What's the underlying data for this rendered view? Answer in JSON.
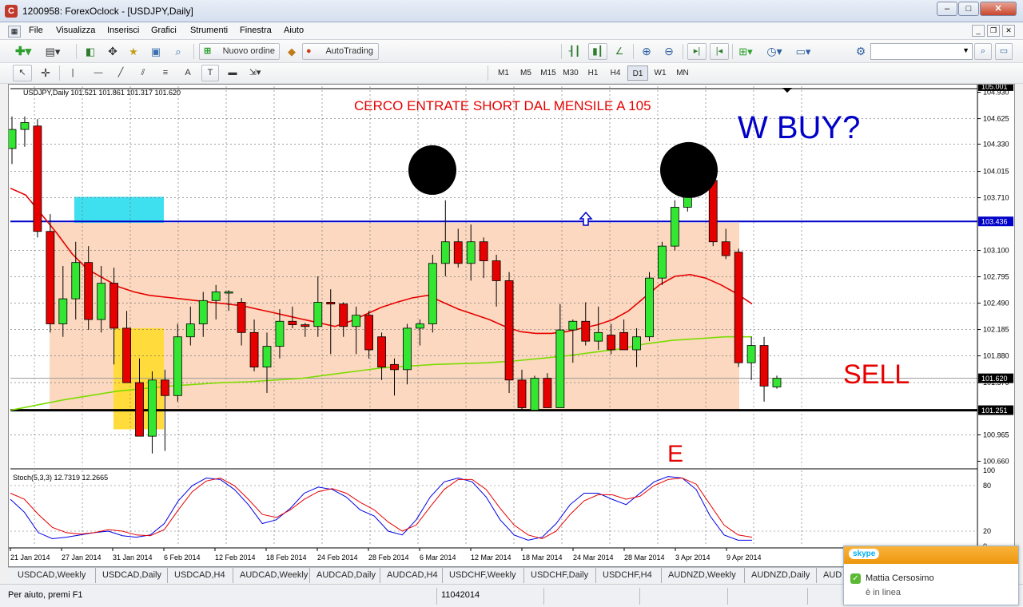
{
  "window": {
    "title": "1200958: ForexOclock - [USDJPY,Daily]",
    "buttons": [
      "–",
      "□",
      "✕"
    ]
  },
  "menu": {
    "items": [
      "File",
      "Visualizza",
      "Inserisci",
      "Grafici",
      "Strumenti",
      "Finestra",
      "Aiuto"
    ]
  },
  "toolbar": {
    "new_order": "Nuovo ordine",
    "autotrading": "AutoTrading",
    "search_placeholder": "",
    "timeframes": [
      "M1",
      "M5",
      "M15",
      "M30",
      "H1",
      "H4",
      "D1",
      "W1",
      "MN"
    ],
    "active_timeframe": "D1",
    "draw_text_tool": "A",
    "draw_label_tool": "T"
  },
  "chart": {
    "symbol_line": "USDJPY,Daily   101.521 101.861 101.317 101.620",
    "current_price": "101.620",
    "resistance_price": "103.436",
    "support_price": "101.251",
    "top_price": "105.001",
    "annotation_top": "CERCO ENTRATE SHORT DAL MENSILE A 105",
    "annotation_wbuy": "W BUY?",
    "annotation_sell": "SELL",
    "annotation_e": "E",
    "colors": {
      "bull": "#32e632",
      "bear": "#e60000",
      "ma_fast": "#e60000",
      "ma_slow": "#7cdc00",
      "zone": "#fbd8bf",
      "cyan_box": "#3ee0f0",
      "yellow_box": "#ffdb3c",
      "resistance": "#0000c8"
    }
  },
  "chart_data": [
    {
      "type": "candlestick",
      "title": "USDJPY,Daily",
      "ylim": [
        100.6,
        105.0
      ],
      "price_ticks": [
        "104.930",
        "104.625",
        "104.330",
        "104.015",
        "103.710",
        "103.100",
        "102.795",
        "102.490",
        "102.185",
        "101.880",
        "101.570",
        "100.965",
        "100.660"
      ],
      "date_ticks": [
        "21 Jan 2014",
        "27 Jan 2014",
        "31 Jan 2014",
        "6 Feb 2014",
        "12 Feb 2014",
        "18 Feb 2014",
        "24 Feb 2014",
        "28 Feb 2014",
        "6 Mar 2014",
        "12 Mar 2014",
        "18 Mar 2014",
        "24 Mar 2014",
        "28 Mar 2014",
        "3 Apr 2014",
        "9 Apr 2014"
      ],
      "candles": [
        {
          "o": 104.28,
          "h": 104.65,
          "l": 104.1,
          "c": 104.5
        },
        {
          "o": 104.5,
          "h": 104.65,
          "l": 104.3,
          "c": 104.58
        },
        {
          "o": 104.54,
          "h": 104.62,
          "l": 103.25,
          "c": 103.32
        },
        {
          "o": 103.32,
          "h": 103.52,
          "l": 102.15,
          "c": 102.25
        },
        {
          "o": 102.25,
          "h": 102.92,
          "l": 102.1,
          "c": 102.54
        },
        {
          "o": 102.54,
          "h": 103.2,
          "l": 102.3,
          "c": 102.96
        },
        {
          "o": 102.96,
          "h": 103.15,
          "l": 102.18,
          "c": 102.3
        },
        {
          "o": 102.3,
          "h": 102.92,
          "l": 102.15,
          "c": 102.72
        },
        {
          "o": 102.72,
          "h": 102.9,
          "l": 101.78,
          "c": 102.2
        },
        {
          "o": 102.2,
          "h": 102.4,
          "l": 101.72,
          "c": 101.57
        },
        {
          "o": 101.57,
          "h": 101.85,
          "l": 100.95,
          "c": 100.95
        },
        {
          "o": 100.95,
          "h": 101.7,
          "l": 100.75,
          "c": 101.6
        },
        {
          "o": 101.6,
          "h": 101.72,
          "l": 100.78,
          "c": 101.42
        },
        {
          "o": 101.42,
          "h": 102.25,
          "l": 101.35,
          "c": 102.1
        },
        {
          "o": 102.1,
          "h": 102.45,
          "l": 102.0,
          "c": 102.25
        },
        {
          "o": 102.25,
          "h": 102.62,
          "l": 102.1,
          "c": 102.52
        },
        {
          "o": 102.52,
          "h": 102.7,
          "l": 102.3,
          "c": 102.62
        },
        {
          "o": 102.62,
          "h": 102.64,
          "l": 102.4,
          "c": 102.62
        },
        {
          "o": 102.5,
          "h": 102.55,
          "l": 102.0,
          "c": 102.15
        },
        {
          "o": 102.15,
          "h": 102.3,
          "l": 101.7,
          "c": 101.75
        },
        {
          "o": 101.75,
          "h": 102.15,
          "l": 101.45,
          "c": 101.99
        },
        {
          "o": 101.99,
          "h": 102.42,
          "l": 101.85,
          "c": 102.28
        },
        {
          "o": 102.28,
          "h": 102.45,
          "l": 102.2,
          "c": 102.24
        },
        {
          "o": 102.24,
          "h": 102.26,
          "l": 102.1,
          "c": 102.22
        },
        {
          "o": 102.22,
          "h": 102.8,
          "l": 102.1,
          "c": 102.5
        },
        {
          "o": 102.5,
          "h": 102.65,
          "l": 101.9,
          "c": 102.48
        },
        {
          "o": 102.48,
          "h": 102.5,
          "l": 102.1,
          "c": 102.22
        },
        {
          "o": 102.22,
          "h": 102.45,
          "l": 101.9,
          "c": 102.35
        },
        {
          "o": 102.35,
          "h": 102.4,
          "l": 101.85,
          "c": 101.95
        },
        {
          "o": 102.1,
          "h": 102.15,
          "l": 101.6,
          "c": 101.75
        },
        {
          "o": 101.78,
          "h": 101.85,
          "l": 101.42,
          "c": 101.72
        },
        {
          "o": 101.72,
          "h": 102.25,
          "l": 101.55,
          "c": 102.2
        },
        {
          "o": 102.2,
          "h": 102.3,
          "l": 102.0,
          "c": 102.25
        },
        {
          "o": 102.25,
          "h": 103.05,
          "l": 102.15,
          "c": 102.95
        },
        {
          "o": 102.95,
          "h": 103.68,
          "l": 102.8,
          "c": 103.2
        },
        {
          "o": 103.2,
          "h": 103.35,
          "l": 102.9,
          "c": 102.95
        },
        {
          "o": 102.95,
          "h": 103.4,
          "l": 102.75,
          "c": 103.2
        },
        {
          "o": 103.2,
          "h": 103.25,
          "l": 102.78,
          "c": 102.98
        },
        {
          "o": 102.98,
          "h": 103.05,
          "l": 102.45,
          "c": 102.75
        },
        {
          "o": 102.75,
          "h": 102.85,
          "l": 101.45,
          "c": 101.6
        },
        {
          "o": 101.6,
          "h": 101.72,
          "l": 101.25,
          "c": 101.28
        },
        {
          "o": 101.25,
          "h": 101.65,
          "l": 101.25,
          "c": 101.62
        },
        {
          "o": 101.62,
          "h": 101.68,
          "l": 101.28,
          "c": 101.28
        },
        {
          "o": 101.28,
          "h": 102.48,
          "l": 101.3,
          "c": 102.18
        },
        {
          "o": 102.18,
          "h": 102.3,
          "l": 101.8,
          "c": 102.28
        },
        {
          "o": 102.28,
          "h": 102.5,
          "l": 102.0,
          "c": 102.05
        },
        {
          "o": 102.05,
          "h": 102.45,
          "l": 101.95,
          "c": 102.15
        },
        {
          "o": 102.12,
          "h": 102.25,
          "l": 101.9,
          "c": 101.95
        },
        {
          "o": 102.15,
          "h": 102.3,
          "l": 101.95,
          "c": 101.95
        },
        {
          "o": 101.95,
          "h": 102.2,
          "l": 101.75,
          "c": 102.1
        },
        {
          "o": 102.1,
          "h": 102.85,
          "l": 102.05,
          "c": 102.78
        },
        {
          "o": 102.78,
          "h": 103.2,
          "l": 102.7,
          "c": 103.15
        },
        {
          "o": 103.15,
          "h": 103.68,
          "l": 103.1,
          "c": 103.6
        },
        {
          "o": 103.6,
          "h": 103.93,
          "l": 103.55,
          "c": 103.85
        },
        {
          "o": 103.85,
          "h": 103.95,
          "l": 103.8,
          "c": 103.88
        },
        {
          "o": 103.91,
          "h": 103.96,
          "l": 103.15,
          "c": 103.2
        },
        {
          "o": 103.2,
          "h": 103.35,
          "l": 103.0,
          "c": 103.04
        },
        {
          "o": 103.08,
          "h": 103.12,
          "l": 101.75,
          "c": 101.8
        },
        {
          "o": 101.8,
          "h": 102.1,
          "l": 101.6,
          "c": 102.0
        },
        {
          "o": 102.0,
          "h": 102.1,
          "l": 101.35,
          "c": 101.53
        },
        {
          "o": 101.52,
          "h": 101.65,
          "l": 101.5,
          "c": 101.62
        }
      ],
      "ma_fast": [
        103.82,
        103.74,
        103.52,
        103.3,
        103.06,
        102.88,
        102.78,
        102.68,
        102.62,
        102.58,
        102.56,
        102.54,
        102.52,
        102.5,
        102.48,
        102.46,
        102.42,
        102.38,
        102.34,
        102.3,
        102.26,
        102.22,
        102.28,
        102.36,
        102.44,
        102.5,
        102.55,
        102.58,
        102.5,
        102.42,
        102.36,
        102.3,
        102.22,
        102.16,
        102.14,
        102.14,
        102.16,
        102.2,
        102.24,
        102.3,
        102.4,
        102.55,
        102.7,
        102.8,
        102.82,
        102.78,
        102.7,
        102.6,
        102.48
      ],
      "ma_slow": [
        101.25,
        101.31,
        101.37,
        101.42,
        101.47,
        101.5,
        101.53,
        101.55,
        101.57,
        101.58,
        101.6,
        101.62,
        101.66,
        101.7,
        101.74,
        101.76,
        101.78,
        101.79,
        101.8,
        101.82,
        101.85,
        101.88,
        101.92,
        101.96,
        102.02,
        102.06,
        102.08,
        102.1,
        102.1
      ],
      "resistance": 103.436,
      "support": 101.251,
      "current": 101.62
    },
    {
      "type": "line",
      "title": "Stoch(5,3,3) 12.7319 12.2665",
      "ylim": [
        0,
        100
      ],
      "ticks": [
        "100",
        "80",
        "20",
        "0"
      ],
      "series": [
        {
          "values": [
            62,
            45,
            18,
            10,
            12,
            15,
            18,
            20,
            14,
            12,
            15,
            30,
            60,
            80,
            90,
            88,
            75,
            55,
            30,
            35,
            50,
            70,
            78,
            75,
            65,
            48,
            40,
            20,
            15,
            35,
            65,
            85,
            90,
            85,
            65,
            35,
            15,
            8,
            12,
            30,
            55,
            70,
            70,
            62,
            55,
            70,
            85,
            92,
            90,
            75,
            40,
            15,
            8,
            8
          ]
        },
        {
          "values": [
            70,
            62,
            42,
            25,
            18,
            16,
            18,
            22,
            20,
            15,
            14,
            22,
            48,
            72,
            86,
            90,
            80,
            62,
            42,
            38,
            48,
            62,
            72,
            76,
            70,
            58,
            48,
            32,
            20,
            28,
            52,
            75,
            88,
            88,
            75,
            50,
            28,
            15,
            10,
            20,
            42,
            60,
            68,
            68,
            62,
            66,
            80,
            88,
            90,
            82,
            55,
            28,
            15,
            12
          ]
        }
      ]
    }
  ],
  "tabs": [
    "USDCAD,Weekly",
    "USDCAD,Daily",
    "USDCAD,H4",
    "AUDCAD,Weekly",
    "AUDCAD,Daily",
    "AUDCAD,H4",
    "USDCHF,Weekly",
    "USDCHF,Daily",
    "USDCHF,H4",
    "AUDNZD,Weekly",
    "AUDNZD,Daily",
    "AUD"
  ],
  "status": {
    "help": "Per aiuto, premi F1",
    "profile": "11042014"
  },
  "skype": {
    "logo": "skype",
    "contact": "Mattia Cersosimo",
    "presence": "è in linea"
  }
}
